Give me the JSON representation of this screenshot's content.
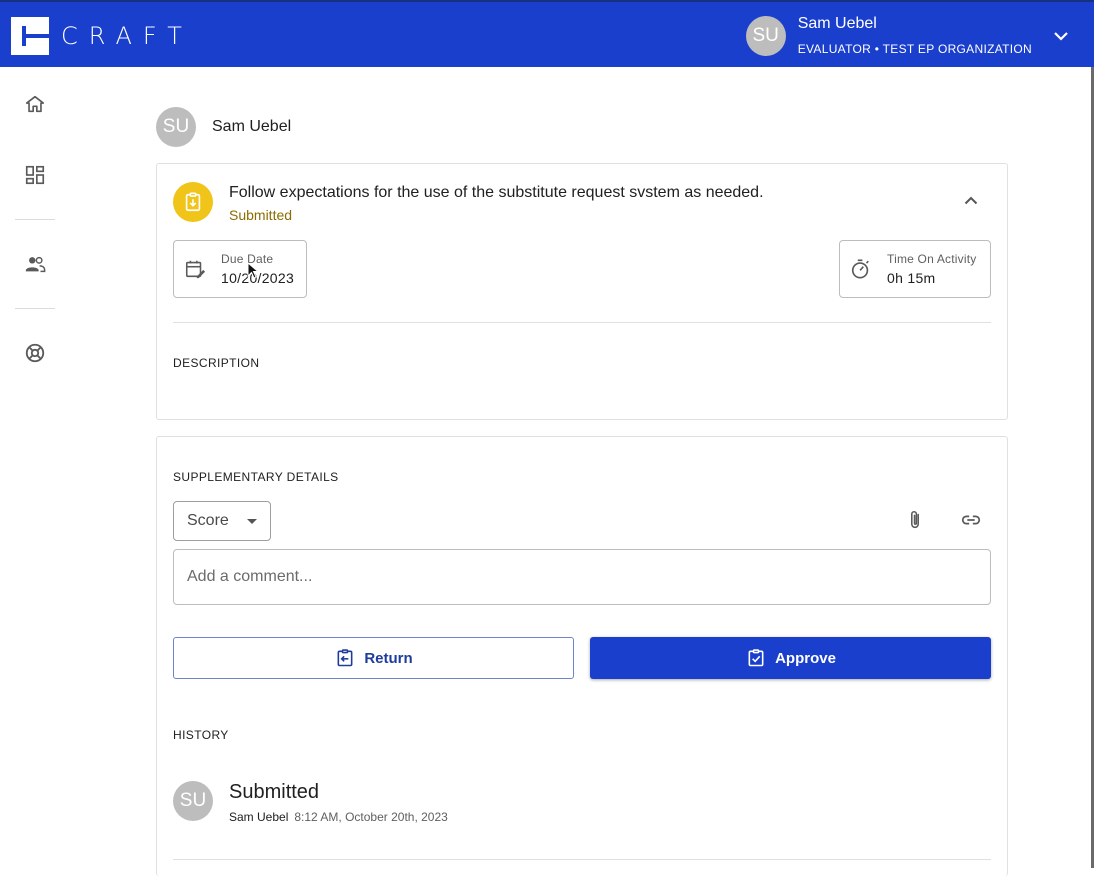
{
  "app": {
    "logo_text": "CRAFT",
    "user": {
      "initials": "SU",
      "name": "Sam Uebel",
      "role": "EVALUATOR • TEST EP ORGANIZATION"
    }
  },
  "sidebar": {
    "items": [
      {
        "icon": "home-icon"
      },
      {
        "icon": "dashboard-icon"
      },
      {
        "icon": "people-icon"
      },
      {
        "icon": "support-icon"
      }
    ]
  },
  "owner": {
    "initials": "SU",
    "name": "Sam Uebel"
  },
  "task": {
    "title": "Follow expectations for the use of the substitute request svstem as needed.",
    "status": "Submitted",
    "status_color": "#8a6d00",
    "icon_color": "#f0c419",
    "due_date_label": "Due Date",
    "due_date_value": "10/20/2023",
    "time_label": "Time On Activity",
    "time_value": "0h 15m",
    "description_label": "DESCRIPTION"
  },
  "supplementary": {
    "label": "SUPPLEMENTARY DETAILS",
    "score_label": "Score",
    "comment_placeholder": "Add a comment...",
    "return_label": "Return",
    "approve_label": "Approve"
  },
  "history": {
    "label": "HISTORY",
    "items": [
      {
        "initials": "SU",
        "title": "Submitted",
        "author": "Sam Uebel",
        "time": "8:12 AM, October 20th, 2023"
      }
    ]
  },
  "colors": {
    "primary": "#1a3fcc",
    "avatar": "#bdbdbd"
  }
}
